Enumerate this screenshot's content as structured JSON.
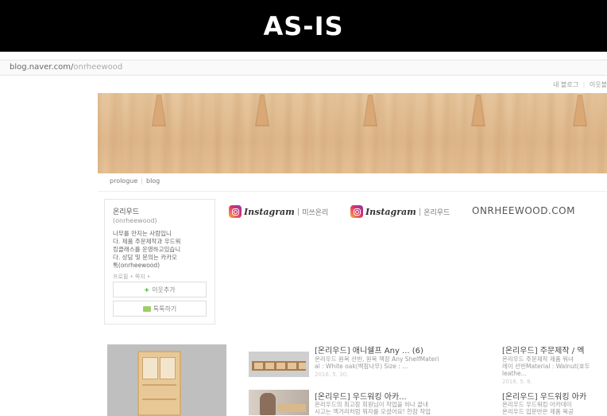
{
  "banner": {
    "title": "AS-IS"
  },
  "browser": {
    "url_host": "blog.naver.com/",
    "url_path": "onrheewood"
  },
  "top_links": {
    "my_blog": "내 블로그",
    "separator": "|",
    "neighbor": "이웃블"
  },
  "menu": {
    "prologue": "prologue",
    "separator": "|",
    "blog": "blog"
  },
  "profile": {
    "name": "온리우드",
    "id": "(onrheewood)",
    "description": [
      "나무를 만지는 사람입니",
      "다. 제품 주문제작과 우드워",
      "킹클래스를 운영하고있습니",
      "다. 상담 및 문의는 카카오",
      "톡(onrheewood)"
    ],
    "links": "프로필 • 쪽지 •",
    "add_neighbor": "이웃추가",
    "chat": "톡톡하기"
  },
  "widgets": {
    "instagram_1": {
      "word": "Instagram",
      "separator": "|",
      "label": "미쓰온리"
    },
    "instagram_2": {
      "word": "Instagram",
      "separator": "|",
      "label": "온리우드"
    },
    "site": "ONRHEEWOOD.COM"
  },
  "posts": [
    {
      "title": "[온리우드] 애니쉘프 Any ... (6)",
      "body": [
        "온리우드 원목 선반, 원목 책장 Any ShelfMateri",
        "al : White oak(백참나무) Size : ..."
      ],
      "date": "2016. 5. 30."
    },
    {
      "title": "[온리우드] 주문제작 / 엑",
      "body": [
        "온리우드 주문제작 제품 워녀",
        "레이 선반Material : Walnut(호두",
        "leathe..."
      ],
      "date": "2016. 5. 8."
    },
    {
      "title": "[온리우드] 우드워킹 아카...",
      "body": [
        "온리우드의 최고참 회원님이 작업을 하나 끝내",
        "시고는 엑거리처럼 뭐자를 오셨어요! 한참 작업"
      ],
      "date": ""
    },
    {
      "title": "[온리우드] 우드워킹 아카",
      "body": [
        "온리우드 우드워킹 아카데미 ",
        "온리우드 입문반은 제품 목공"
      ],
      "date": ""
    }
  ],
  "colors": {
    "banner_bg": "#000000",
    "accent_green": "#2db400",
    "wood": "#dfb98d"
  },
  "icons": [
    "instagram-icon",
    "plus-icon",
    "chat-icon"
  ]
}
